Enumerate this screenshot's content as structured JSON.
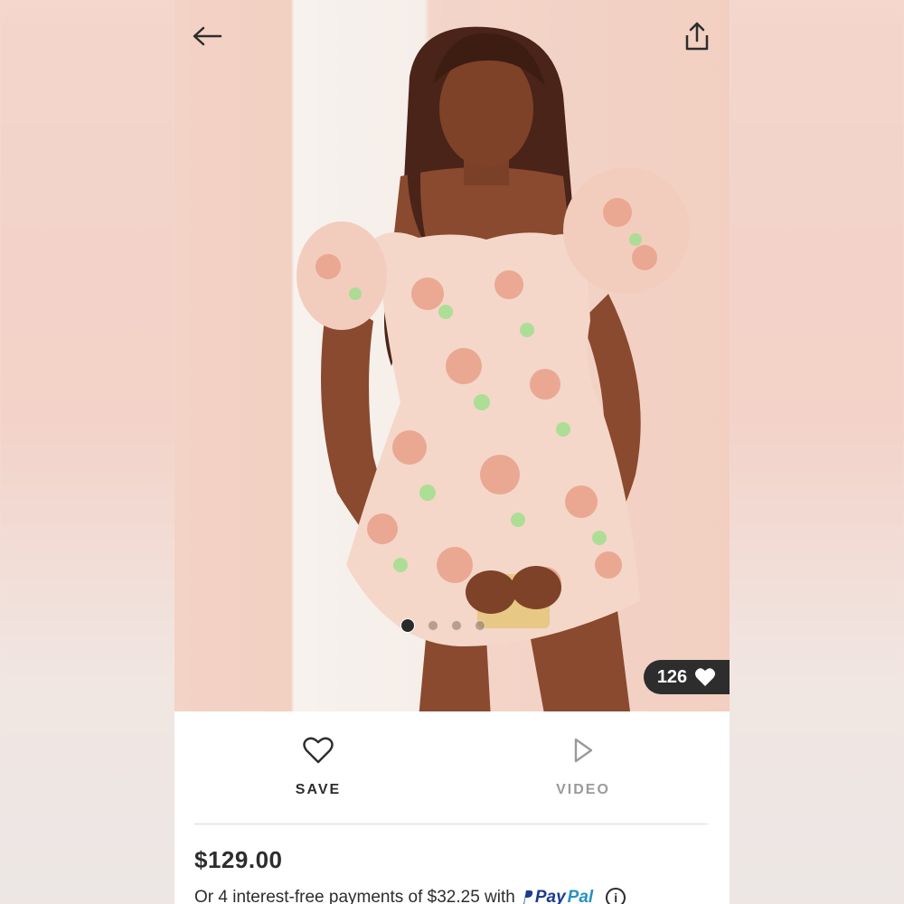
{
  "header": {
    "back_icon": "arrow-left-icon",
    "share_icon": "share-icon"
  },
  "gallery": {
    "image_count": 4,
    "active_index": 0,
    "likes": "126",
    "likes_icon": "heart-filled-icon"
  },
  "actions": {
    "save_label": "SAVE",
    "save_icon": "heart-outline-icon",
    "video_label": "VIDEO",
    "video_icon": "play-icon"
  },
  "product": {
    "price": "$129.00",
    "installments_text": "Or 4 interest-free payments of $32.25 with",
    "paypal_first": "Pay",
    "paypal_second": "Pal",
    "info_icon": "info-icon"
  },
  "colors": {
    "dark": "#2d2d2d",
    "muted": "#9a9a9a",
    "paypal_blue": "#1b3c8f",
    "paypal_light": "#2790c3"
  }
}
